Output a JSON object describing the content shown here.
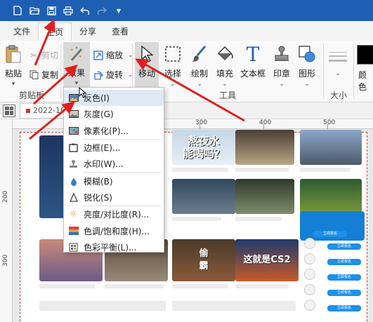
{
  "quick_access": {
    "new_icon": "new-file-icon",
    "open_icon": "folder-open-icon",
    "save_icon": "save-icon",
    "print_icon": "printer-icon",
    "undo_icon": "undo-icon",
    "redo_icon": "redo-icon",
    "customize_icon": "dropdown-arrow-icon"
  },
  "tabs": [
    {
      "label": "文件"
    },
    {
      "label": "主页",
      "active": true
    },
    {
      "label": "分享"
    },
    {
      "label": "查看"
    }
  ],
  "ribbon": {
    "clipboard": {
      "paste": "粘贴",
      "cut": "剪切",
      "copy": "复制",
      "group_label": "剪贴板"
    },
    "image": {
      "effects": "效果",
      "resize": "缩放",
      "rotate": "旋转"
    },
    "tools": {
      "move": "移动",
      "select": "选择",
      "draw": "绘制",
      "fill": "填充",
      "textbox": "文本框",
      "stamp": "印章",
      "shape": "图形",
      "group_label": "工具"
    },
    "size": {
      "group_label": "大小"
    },
    "color": {
      "label": "颜色"
    }
  },
  "subbar": {
    "doc_tab": "2022-10-"
  },
  "ruler": {
    "h_labels": [
      "300",
      "400",
      "500"
    ],
    "v_labels": [
      "200",
      "300"
    ]
  },
  "effects_menu": [
    {
      "label": "反色(I)",
      "icon": "invert-icon"
    },
    {
      "label": "灰度(G)",
      "icon": "grayscale-icon"
    },
    {
      "label": "像素化(P)...",
      "icon": "pixelate-icon"
    },
    {
      "label": "边框(E)...",
      "icon": "border-icon"
    },
    {
      "label": "水印(W)...",
      "icon": "watermark-icon"
    },
    {
      "label": "模糊(B)",
      "icon": "blur-drop-icon"
    },
    {
      "label": "锐化(S)",
      "icon": "sharpen-icon"
    },
    {
      "label": "亮度/对比度(R)...",
      "icon": "brightness-icon"
    },
    {
      "label": "色调/饱和度(H)...",
      "icon": "hue-icon"
    },
    {
      "label": "色彩平衡(L)...",
      "icon": "color-balance-icon"
    }
  ],
  "canvas": {
    "thumb_texts": {
      "t1": "熬夜水\n能喝吗？",
      "t2": "偷\n霸",
      "t3": "这就是CS2"
    },
    "chat_button": "立即报名",
    "colors": {
      "brand_blue": "#1e5fb4",
      "annotation_red": "#e02020",
      "chat_blue": "#1380d6"
    }
  }
}
